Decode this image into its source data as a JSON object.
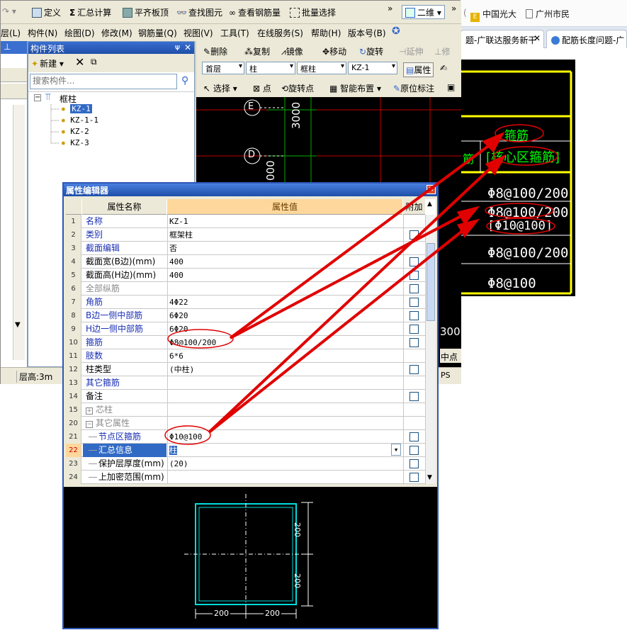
{
  "browser": {
    "bookmarks": [
      "中国光大",
      "广州市民"
    ],
    "tabs": [
      "题-广联达服务新干",
      "配筋长度问题-广"
    ],
    "colors": {
      "tab_bg": "#dfe7f1"
    }
  },
  "toolbar_top": {
    "buttons": [
      "定义",
      "汇总计算",
      "平齐板顶",
      "查找图元",
      "查看钢筋量",
      "批量选择"
    ],
    "view_mode": "二维"
  },
  "menu": [
    "层(L)",
    "构件(N)",
    "绘图(D)",
    "修改(M)",
    "钢筋量(Q)",
    "视图(V)",
    "工具(T)",
    "在线服务(S)",
    "帮助(H)",
    "版本号(B)"
  ],
  "component_list": {
    "title": "构件列表",
    "new_label": "新建",
    "search_placeholder": "搜索构件...",
    "root": "框柱",
    "items": [
      "KZ-1",
      "KZ-1-1",
      "KZ-2",
      "KZ-3"
    ]
  },
  "edit_toolbar": {
    "row1": [
      "删除",
      "复制",
      "镜像",
      "移动",
      "旋转",
      "延伸",
      "修"
    ],
    "floor": "首层",
    "type": "柱",
    "subtype": "框柱",
    "element": "KZ-1",
    "prop_label": "属性",
    "row3": [
      "选择",
      "点",
      "旋转点",
      "智能布置",
      "原位标注"
    ]
  },
  "cad_main": {
    "grid_labels": [
      "E",
      "D"
    ],
    "dim_3000": "3000",
    "dim_000": "000",
    "bottom_300": "300"
  },
  "status": {
    "floor_height": "层高:3m",
    "mid_point": "中点",
    "ps": "PS"
  },
  "cad_right": {
    "title": "箍筋",
    "core": "[核心区箍筋]",
    "left_frag": "筋",
    "values": [
      "Φ8@100/200",
      "Φ8@100/200",
      "[Φ10@100]",
      "Φ8@100/200",
      "Φ8@100"
    ]
  },
  "prop_editor": {
    "title": "属性编辑器",
    "headers": {
      "name": "属性名称",
      "value": "属性值",
      "extra": "附加"
    },
    "rows": [
      {
        "no": "1",
        "name": "名称",
        "value": "KZ-1",
        "cb": false,
        "style": "blue"
      },
      {
        "no": "2",
        "name": "类别",
        "value": "框架柱",
        "cb": true,
        "style": "blue"
      },
      {
        "no": "3",
        "name": "截面编辑",
        "value": "否",
        "cb": false,
        "style": "blue"
      },
      {
        "no": "4",
        "name": "截面宽(B边)(mm)",
        "value": "400",
        "cb": true,
        "style": "normal"
      },
      {
        "no": "5",
        "name": "截面高(H边)(mm)",
        "value": "400",
        "cb": true,
        "style": "normal"
      },
      {
        "no": "6",
        "name": "全部纵筋",
        "value": "",
        "cb": true,
        "style": "gray"
      },
      {
        "no": "7",
        "name": "角筋",
        "value": "4Φ22",
        "cb": true,
        "style": "blue"
      },
      {
        "no": "8",
        "name": "B边一侧中部筋",
        "value": "6Φ20",
        "cb": true,
        "style": "blue"
      },
      {
        "no": "9",
        "name": "H边一侧中部筋",
        "value": "6Φ20",
        "cb": true,
        "style": "blue"
      },
      {
        "no": "10",
        "name": "箍筋",
        "value": "Φ8@100/200",
        "cb": true,
        "style": "blue"
      },
      {
        "no": "11",
        "name": "肢数",
        "value": "6*6",
        "cb": false,
        "style": "blue"
      },
      {
        "no": "12",
        "name": "柱类型",
        "value": "(中柱)",
        "cb": true,
        "style": "normal"
      },
      {
        "no": "13",
        "name": "其它箍筋",
        "value": "",
        "cb": false,
        "style": "blue"
      },
      {
        "no": "14",
        "name": "备注",
        "value": "",
        "cb": true,
        "style": "normal"
      },
      {
        "no": "15",
        "name": "芯柱",
        "value": "",
        "cb": false,
        "style": "gray",
        "expander": "+"
      },
      {
        "no": "20",
        "name": "其它属性",
        "value": "",
        "cb": false,
        "style": "gray",
        "expander": "−"
      },
      {
        "no": "21",
        "name": "节点区箍筋",
        "value": "Φ10@100",
        "cb": true,
        "style": "blue",
        "indent": true
      },
      {
        "no": "22",
        "name": "汇总信息",
        "value": "柱",
        "cb": true,
        "style": "selected",
        "indent": true
      },
      {
        "no": "23",
        "name": "保护层厚度(mm)",
        "value": "(20)",
        "cb": true,
        "style": "normal",
        "indent": true
      },
      {
        "no": "24",
        "name": "上加密范围(mm)",
        "value": "",
        "cb": true,
        "style": "normal",
        "indent": true
      }
    ],
    "preview_dims": [
      "200",
      "200",
      "200",
      "200"
    ]
  }
}
